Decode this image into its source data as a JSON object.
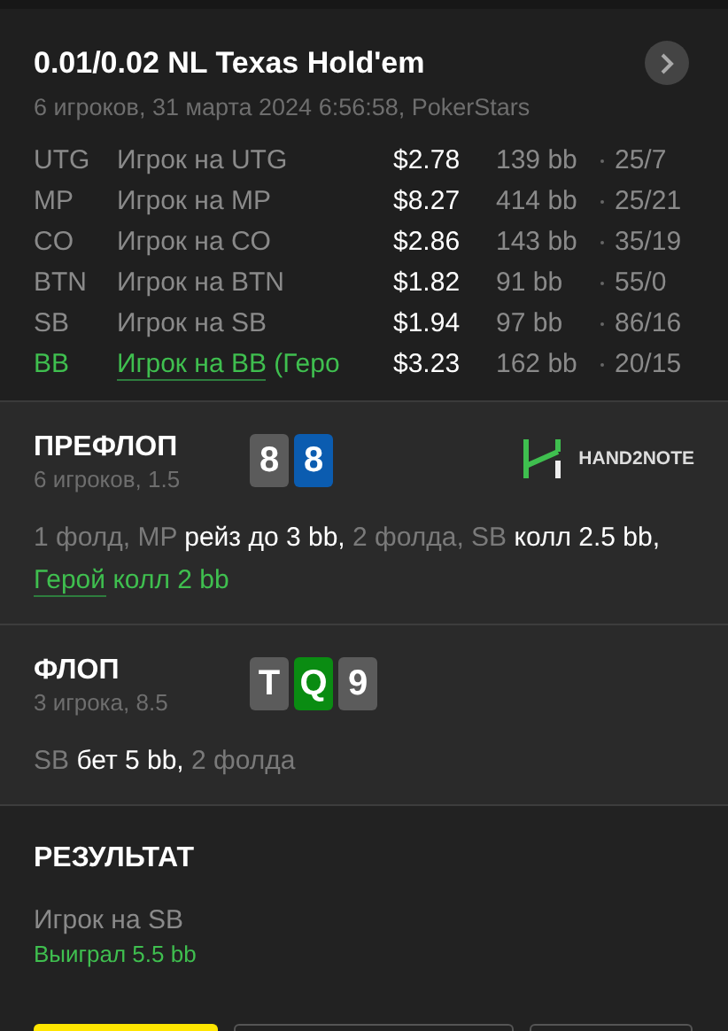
{
  "header": {
    "title": "0.01/0.02 NL Texas Hold'em",
    "subtitle": "6 игроков, 31 марта 2024 6:56:58, PokerStars"
  },
  "players": [
    {
      "position": "UTG",
      "name": "Игрок на UTG",
      "stack": "$2.78",
      "bb": "139 bb",
      "stats": "25/7",
      "hero": false
    },
    {
      "position": "MP",
      "name": "Игрок на MP",
      "stack": "$8.27",
      "bb": "414 bb",
      "stats": "25/21",
      "hero": false
    },
    {
      "position": "CO",
      "name": "Игрок на CO",
      "stack": "$2.86",
      "bb": "143 bb",
      "stats": "35/19",
      "hero": false
    },
    {
      "position": "BTN",
      "name": "Игрок на BTN",
      "stack": "$1.82",
      "bb": "91 bb",
      "stats": "55/0",
      "hero": false
    },
    {
      "position": "SB",
      "name": "Игрок на SB",
      "stack": "$1.94",
      "bb": "97 bb",
      "stats": "86/16",
      "hero": false
    },
    {
      "position": "BB",
      "name": "Игрок на BB",
      "suffix": "(Геро",
      "stack": "$3.23",
      "bb": "162 bb",
      "stats": "20/15",
      "hero": true
    }
  ],
  "streets": [
    {
      "title": "ПРЕФЛОП",
      "info": "6 игроков, 1.5",
      "logo": {
        "text": "HAND2NOTE"
      },
      "cards": [
        {
          "rank": "8",
          "color": "#5b5b5b"
        },
        {
          "rank": "8",
          "color": "#0b5cb0"
        }
      ],
      "actions": [
        {
          "kind": "muted",
          "text": "1 фолд, MP "
        },
        {
          "kind": "bold",
          "text": "рейз до 3 bb,"
        },
        {
          "kind": "muted",
          "text": " 2 фолда, SB "
        },
        {
          "kind": "bold",
          "text": "колл 2.5 bb,"
        },
        {
          "kind": "hero_link",
          "text": " Герой"
        },
        {
          "kind": "hero",
          "text": " колл 2 bb"
        }
      ]
    },
    {
      "title": "ФЛОП",
      "info": "3 игрока, 8.5",
      "cards": [
        {
          "rank": "T",
          "color": "#5b5b5b"
        },
        {
          "rank": "Q",
          "color": "#0a8c12"
        },
        {
          "rank": "9",
          "color": "#5b5b5b"
        }
      ],
      "actions": [
        {
          "kind": "muted",
          "text": "SB "
        },
        {
          "kind": "bold",
          "text": "бет 5 bb,"
        },
        {
          "kind": "muted",
          "text": " 2 фолда"
        }
      ]
    }
  ],
  "result": {
    "title": "РЕЗУЛЬТАТ",
    "player": "Игрок на SB",
    "outcome": "Выиграл 5.5 bb"
  },
  "buttons": [
    {
      "kind": "primary"
    },
    {
      "kind": "outline"
    },
    {
      "kind": "outline"
    }
  ]
}
